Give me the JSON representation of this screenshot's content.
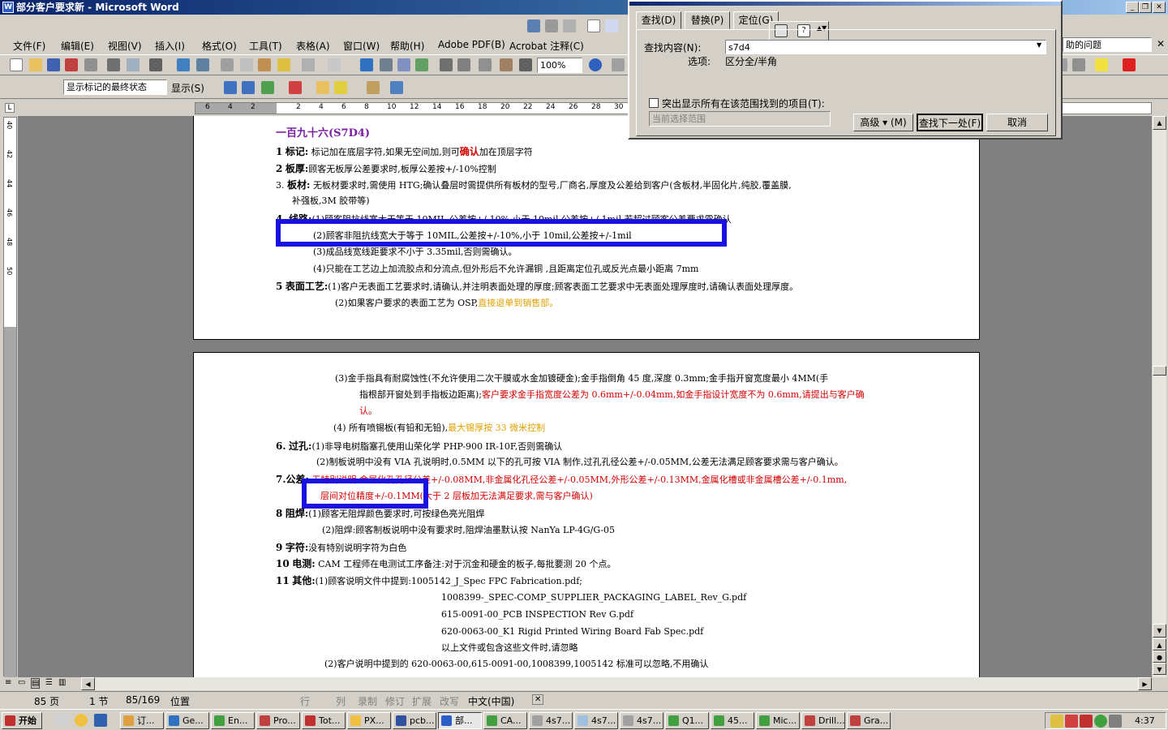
{
  "window": {
    "title": "部分客户要求新 - Microsoft Word"
  },
  "menu": [
    "文件(F)",
    "编辑(E)",
    "视图(V)",
    "插入(I)",
    "格式(O)",
    "工具(T)",
    "表格(A)",
    "窗口(W)",
    "帮助(H)",
    "Adobe PDF(B)",
    "Acrobat 注释(C)"
  ],
  "help_box": {
    "placeholder": "助的问题"
  },
  "toolbar": {
    "zoom": "100%"
  },
  "reviewing": {
    "display_mode": "显示标记的最终状态",
    "show_label": "显示(S)"
  },
  "ruler_ticks": [
    "6",
    "4",
    "2",
    "",
    "2",
    "4",
    "6",
    "8",
    "10",
    "12",
    "14",
    "16",
    "18",
    "20",
    "22",
    "24",
    "26",
    "28",
    "30"
  ],
  "vruler_ticks": [
    "40",
    "42",
    "44",
    "46",
    "48",
    "50"
  ],
  "find_dialog": {
    "tabs": [
      "查找(D)",
      "替换(P)",
      "定位(G)"
    ],
    "find_label": "查找内容(N):",
    "find_value": "s7d4",
    "options_label": "选项:",
    "options_value": "区分全/半角",
    "highlight_all_label": "突出显示所有在该范围找到的项目(T):",
    "scope_value": "当前选择范围",
    "advanced_button": "高级 ▾ (M)",
    "find_next_button": "查找下一处(F)",
    "cancel_button": "取消"
  },
  "doc": {
    "page1": {
      "heading": "一百九十六(S7D4)",
      "l1_num": "1",
      "l1_head": "标记:",
      "l1_a": "标记加在底层字符,如果无空间加,则可",
      "l1_red": "确认",
      "l1_b": "加在顶层字符",
      "l2_num": "2",
      "l2_head": "板厚:",
      "l2_text": "顾客无板厚公差要求时,板厚公差按+/-10%控制",
      "l3_num": "3.",
      "l3_head": "板材:",
      "l3_text": "无板材要求时,需使用 HTG;确认叠层时需提供所有板材的型号,厂商名,厚度及公差给到客户(含板材,半固化片,纯胶,覆盖膜,",
      "l3_cont": "补强板,3M 胶带等)",
      "l4_num": "4.",
      "l4_head": "线路:",
      "l4_text": "(1)顾客阻抗线宽大于等于 10MIL,公差按+/-10%,小于 10mil,公差按+/-1mil 若超过顾客公差要求需确认",
      "l4_2": "(2)顾客非阻抗线宽大于等于 10MIL,公差按+/-10%,小于 10mil,公差按+/-1mil",
      "l4_3": "(3)成品线宽线距要求不小于 3.35mil,否则需确认。",
      "l4_4": "(4)只能在工艺边上加流胶点和分流点,但外形后不允许漏铜 ,且距离定位孔或反光点最小距离 7mm",
      "l5_num": "5",
      "l5_head": "表面工艺:",
      "l5_text": "(1)客户无表面工艺要求时,请确认,并注明表面处理的厚度;顾客表面工艺要求中无表面处理厚度时,请确认表面处理厚度。",
      "l5_2a": "(2)如果客户要求的表面工艺为 OSP,",
      "l5_2b": "直接退单到销售部。"
    },
    "page2": {
      "l5_3a": "(3)金手指具有耐腐蚀性(不允许使用二次干膜或水金加镀硬金);金手指倒角 45 度,深度 0.3mm;金手指开窗宽度最小 4MM(手",
      "l5_3b": "指根部开窗处到手指板边距离);",
      "l5_3red": "客户要求金手指宽度公差为 0.6mm+/-0.04mm,如金手指设计宽度不为 0.6mm,请提出与客户确",
      "l5_3c": "认。",
      "l5_4a": "(4)  所有喷锡板(有铅和无铅),",
      "l5_4b": "最大锡厚按 33 微米控制",
      "l6_num": "6.",
      "l6_head": "过孔:",
      "l6_text": "(1)非导电树脂塞孔使用山荣化学 PHP-900 IR-10F,否则需确认",
      "l6_2": "(2)制板说明中没有 VIA 孔说明时,0.5MM 以下的孔可按 VIA 制作,过孔孔径公差+/-0.05MM,公差无法满足顾客要求需与客户确认。",
      "l7_head": "7.公差:",
      "l7_red": "无特别说明:金属化孔孔径公差+/-0.08MM,非金属化孔径公差+/-0.05MM,外形公差+/-0.13MM,金属化槽或非金属槽公差+/-0.1mm,",
      "l7_red2": "层间对位精度+/-0.1MM(大于 2 层板加无法满足要求,需与客户确认)",
      "l8_num": "8",
      "l8_head": "阻焊:",
      "l8_text": "(1)顾客无阻焊颜色要求时,可按绿色亮光阻焊",
      "l8_2": "(2)阻焊:顾客制板说明中没有要求时,阻焊油墨默认按 NanYa LP-4G/G-05",
      "l9_num": "9",
      "l9_head": "字符:",
      "l9_text": "没有特别说明字符为白色",
      "l10_num": "10",
      "l10_head": "电测:",
      "l10_text": "CAM 工程师在电测试工序备注:对于沉金和硬金的板子,每批要测 20 个点。",
      "l11_num": "11",
      "l11_head": "其他:",
      "l11_text": "(1)顾客说明文件中提到:1005142_J_Spec FPC Fabrication.pdf;",
      "files": [
        "1008399-_SPEC-COMP_SUPPLIER_PACKAGING_LABEL_Rev_G.pdf",
        "615-0091-00_PCB INSPECTION Rev G.pdf",
        "620-0063-00_K1 Rigid Printed Wiring Board Fab Spec.pdf"
      ],
      "ignore": "以上文件或包含这些文件时,请忽略",
      "l11_2": "(2)客户说明中提到的 620-0063-00,615-0091-00,1008399,1005142 标准可以忽略,不用确认"
    }
  },
  "status": {
    "page": "85 页",
    "section": "1 节",
    "pages": "85/169",
    "position": "位置",
    "row": "行",
    "col": "列",
    "rec": "录制",
    "trk": "修订",
    "ext": "扩展",
    "ovr": "改写",
    "lang": "中文(中国)"
  },
  "taskbar": {
    "start": "开始",
    "tasks": [
      "订...",
      "Ge...",
      "En...",
      "Pro...",
      "Tot...",
      "PX...",
      "pcb...",
      "部...",
      "CA...",
      "4s7...",
      "4s7...",
      "4s7...",
      "Q1...",
      "45...",
      "Mic...",
      "Drill...",
      "Gra..."
    ],
    "clock": "4:37"
  },
  "colors": {
    "highlight_box": "#1a10e0",
    "title_bar": "#0a246a",
    "red_text": "#d40000",
    "orange_text": "#e0a000"
  }
}
